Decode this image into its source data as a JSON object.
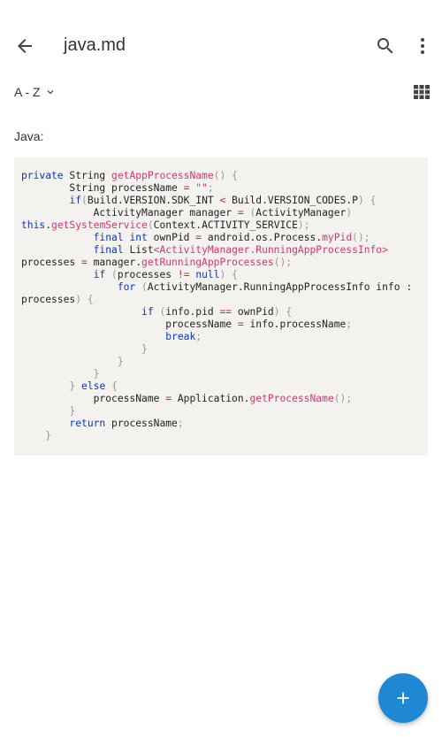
{
  "appbar": {
    "title": "java.md",
    "icons": [
      "arrow-back-icon",
      "search-icon",
      "more-vert-icon"
    ]
  },
  "sort": {
    "label": "A - Z",
    "icon": "chevron-down-icon"
  },
  "view_toggle": {
    "icon": "grid-view-icon"
  },
  "content": {
    "section_label": "Java:",
    "code_lines": [
      "private String getAppProcessName() {",
      "        String processName = \"\";",
      "        if(Build.VERSION.SDK_INT < Build.VERSION_CODES.P) {",
      "            ActivityManager manager = (ActivityManager)",
      "this.getSystemService(Context.ACTIVITY_SERVICE);",
      "            final int ownPid = android.os.Process.myPid();",
      "            final List<ActivityManager.RunningAppProcessInfo>",
      "processes = manager.getRunningAppProcesses();",
      "            if (processes != null) {",
      "                for (ActivityManager.RunningAppProcessInfo info :",
      "processes) {",
      "                    if (info.pid == ownPid) {",
      "                        processName = info.processName;",
      "                        break;",
      "                    }",
      "                }",
      "            }",
      "        } else {",
      "            processName = Application.getProcessName();",
      "        }",
      "        return processName;",
      "    }"
    ]
  },
  "fab": {
    "icon": "add-icon"
  },
  "colors": {
    "accent": "#1e88d2",
    "code_background": "#f4f2ef",
    "keyword": "#0a35c5",
    "method": "#d83472"
  }
}
